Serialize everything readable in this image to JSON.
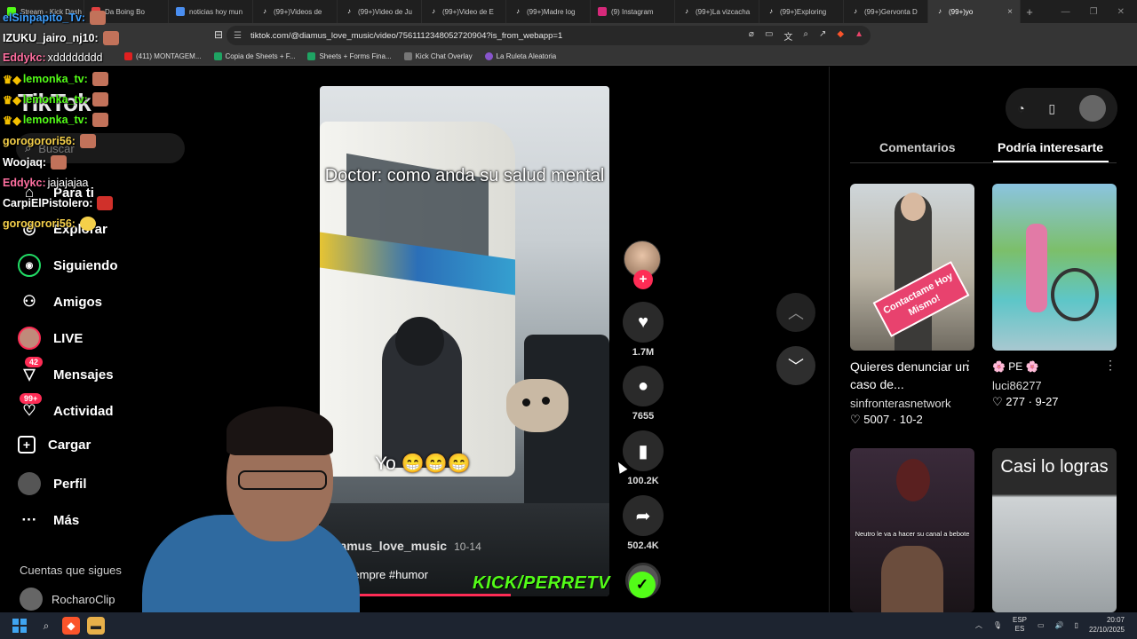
{
  "browser": {
    "tabs": [
      {
        "label": "Stream - Kick Dash",
        "fav_color": "#53fc18"
      },
      {
        "label": "Da Boing Bo",
        "fav_color": "#e04040"
      },
      {
        "label": "noticias hoy mun",
        "fav_color": "#4a8ef0"
      },
      {
        "label": "(99+)Videos de",
        "fav_color": "#111111"
      },
      {
        "label": "(99+)Video de Ju",
        "fav_color": "#111111"
      },
      {
        "label": "(99+)Video de E",
        "fav_color": "#111111"
      },
      {
        "label": "(99+)Madre log",
        "fav_color": "#111111"
      },
      {
        "label": "(9) Instagram",
        "fav_color": "#d6297a"
      },
      {
        "label": "(99+)La vizcacha",
        "fav_color": "#111111"
      },
      {
        "label": "(99+)Exploring",
        "fav_color": "#111111"
      },
      {
        "label": "(99+)Gervonta D",
        "fav_color": "#111111"
      },
      {
        "label": "(99+)yo",
        "fav_color": "#111111",
        "active": true
      }
    ],
    "url": "tiktok.com/@diamus_love_music/video/7561112348052720904?is_from_webapp=1",
    "bookmarks": [
      {
        "label": "(411) MONTAGEM...",
        "color": "#e02020"
      },
      {
        "label": "Copia de Sheets + F...",
        "color": "#1fa463"
      },
      {
        "label": "Sheets + Forms Fina...",
        "color": "#1fa463"
      },
      {
        "label": "Kick Chat Overlay",
        "color": "#777777"
      },
      {
        "label": "La Ruleta Aleatoria",
        "color": "#8855cc"
      }
    ]
  },
  "tiktok": {
    "logo": "TikTok",
    "search_placeholder": "Buscar",
    "nav": [
      {
        "label": "Para ti",
        "icon": "home-icon"
      },
      {
        "label": "Explorar",
        "icon": "compass-icon"
      },
      {
        "label": "Siguiendo",
        "icon": "following-icon"
      },
      {
        "label": "Amigos",
        "icon": "friends-icon"
      },
      {
        "label": "LIVE",
        "icon": "live-icon"
      },
      {
        "label": "Mensajes",
        "icon": "message-icon",
        "badge": "42"
      },
      {
        "label": "Actividad",
        "icon": "activity-icon",
        "badge": "99+"
      },
      {
        "label": "Cargar",
        "icon": "upload-icon"
      },
      {
        "label": "Perfil",
        "icon": "profile-icon"
      },
      {
        "label": "Más",
        "icon": "more-icon"
      }
    ],
    "following_heading": "Cuentas que sigues",
    "followed_account": "RocharoClip"
  },
  "chat": [
    {
      "user": "elSinpapito_Tv:",
      "msg": "",
      "color": "#3fa0ff"
    },
    {
      "user": "IZUKU_jairo_nj10:",
      "msg": "",
      "color": "#ffffff"
    },
    {
      "user": "Eddykc:",
      "msg": "xdddddddd",
      "color": "#ff6fa0"
    },
    {
      "user": "lemonka_tv:",
      "msg": "",
      "color": "#53fc18"
    },
    {
      "user": "lemonka_tv:",
      "msg": "",
      "color": "#53fc18"
    },
    {
      "user": "lemonka_tv:",
      "msg": "",
      "color": "#53fc18"
    },
    {
      "user": "gorogorori56:",
      "msg": "",
      "color": "#f5d04a"
    },
    {
      "user": "Woojaq:",
      "msg": "",
      "color": "#ffffff"
    },
    {
      "user": "Eddykc:",
      "msg": "jajajajaa",
      "color": "#ff6fa0"
    },
    {
      "user": "CarpiElPistolero:",
      "msg": "",
      "color": "#ffffff"
    },
    {
      "user": "gorogorori56:",
      "msg": "",
      "color": "#f5d04a"
    }
  ],
  "video": {
    "caption": "Doctor:  como anda su salud mental",
    "overlay_text": "Yo 😁😁😁",
    "author": "diamus_love_music",
    "date": "10-14",
    "description": "siempre #humor",
    "likes": "1.7M",
    "comments": "7655",
    "saves": "100.2K",
    "shares": "502.4K"
  },
  "panel": {
    "tab_comments": "Comentarios",
    "tab_suggested": "Podría interesarte",
    "cards": [
      {
        "title": "Quieres denunciar un caso de...",
        "user": "sinfronterasnetwork",
        "stats": "♡ 5007 · 10-2",
        "tag": "Contactame Hoy Mismo!"
      },
      {
        "title": "🌸 PE 🌸",
        "user": "luci86277",
        "stats": "♡ 277 · 9-27"
      },
      {
        "subtitle": "Neutro le va a hacer su canal a bebote"
      },
      {
        "overlay": "Casi lo logras"
      }
    ]
  },
  "overlay": {
    "kick_text": "KICK/PERRETV"
  },
  "taskbar": {
    "lang_top": "ESP",
    "lang_bottom": "ES",
    "time": "20:07",
    "date": "22/10/2025"
  }
}
